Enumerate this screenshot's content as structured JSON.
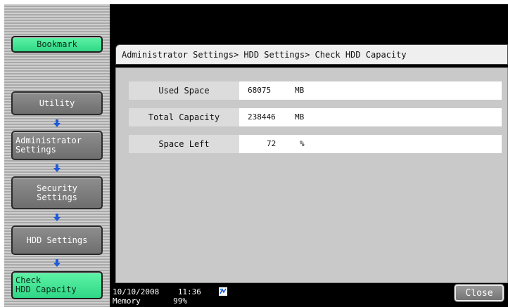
{
  "sidebar": {
    "bookmark": "Bookmark",
    "utility": "Utility",
    "admin_settings": "Administrator\nSettings",
    "security_settings": "Security\nSettings",
    "hdd_settings": "HDD Settings",
    "check_hdd": "Check\nHDD Capacity"
  },
  "header": {
    "breadcrumb": "Administrator Settings> HDD Settings> Check HDD Capacity"
  },
  "rows": [
    {
      "label": "Used Space",
      "value": "68075",
      "unit": "MB"
    },
    {
      "label": "Total Capacity",
      "value": "238446",
      "unit": "MB"
    },
    {
      "label": "Space Left",
      "value": "72",
      "unit": "%"
    }
  ],
  "footer": {
    "datetime": "10/10/2008    11:36",
    "memory": "Memory       99%",
    "close_label": "Close"
  },
  "colors": {
    "accent_green": "#3fe596",
    "nav_arrow_blue": "#1e5bd8"
  },
  "icons": {
    "status": "network-status-icon",
    "nav_arrow": "arrow-down-icon"
  }
}
